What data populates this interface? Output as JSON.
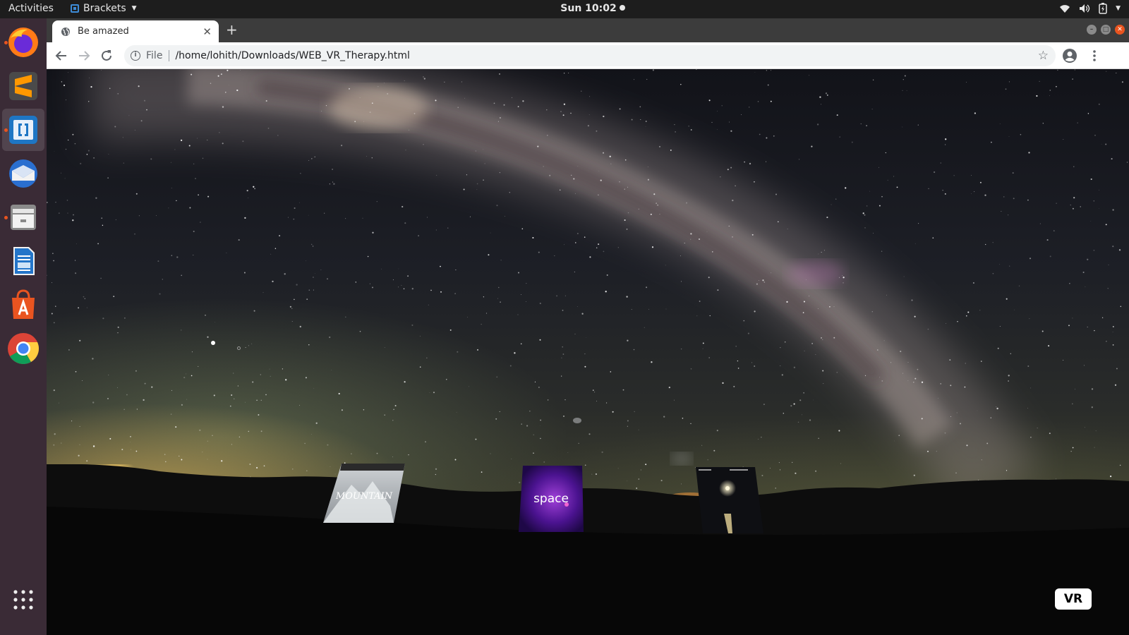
{
  "topbar": {
    "activities": "Activities",
    "app_name": "Brackets",
    "clock": "Sun 10:02"
  },
  "dock": {
    "items": [
      {
        "name": "firefox",
        "running": true
      },
      {
        "name": "sublime-text",
        "running": false
      },
      {
        "name": "brackets",
        "running": true,
        "active": true
      },
      {
        "name": "thunderbird",
        "running": false
      },
      {
        "name": "files",
        "running": true
      },
      {
        "name": "libreoffice-writer",
        "running": false
      },
      {
        "name": "ubuntu-software",
        "running": false
      },
      {
        "name": "chrome",
        "running": false
      }
    ],
    "show_apps": "show-apps-grid"
  },
  "browser": {
    "tab_title": "Be amazed",
    "address_scheme": "File",
    "address_url": "/home/lohith/Downloads/WEB_VR_Therapy.html"
  },
  "scene": {
    "panels": [
      {
        "name": "mountain",
        "label": "MOUNTAIN"
      },
      {
        "name": "space",
        "label": "space"
      },
      {
        "name": "night-sea",
        "label": ""
      }
    ],
    "vr_button": "VR"
  },
  "colors": {
    "topbar": "#1d1d1d",
    "dock": "#3a2b36",
    "accent": "#e95420",
    "tabstrip": "#3c3c3c"
  }
}
